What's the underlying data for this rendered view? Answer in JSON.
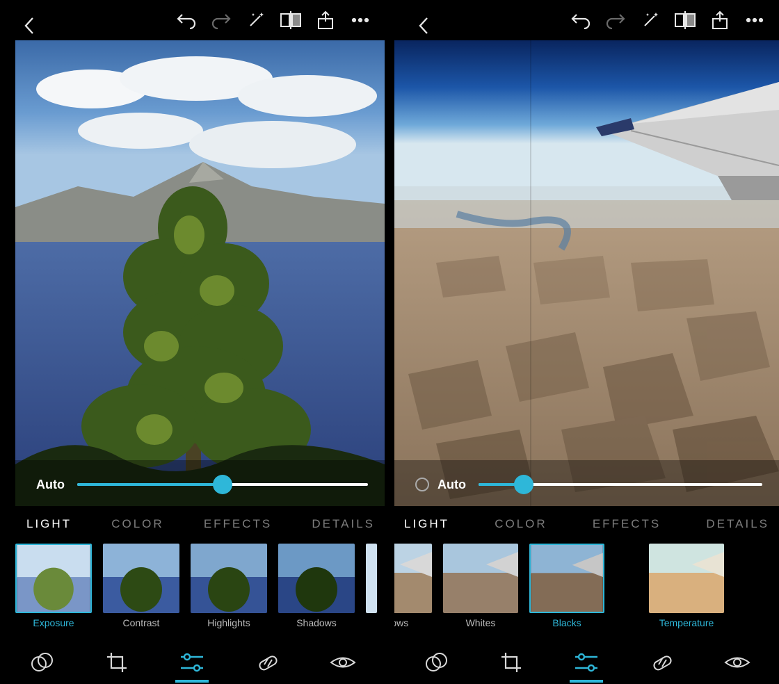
{
  "left": {
    "slider": {
      "auto_label": "Auto",
      "show_radio": false,
      "value_percent": 50
    },
    "tabs": [
      {
        "label": "LIGHT",
        "active": true
      },
      {
        "label": "COLOR",
        "active": false
      },
      {
        "label": "EFFECTS",
        "active": false
      },
      {
        "label": "DETAILS",
        "active": false
      }
    ],
    "presets": [
      {
        "label": "Exposure",
        "selected": true
      },
      {
        "label": "Contrast",
        "selected": false
      },
      {
        "label": "Highlights",
        "selected": false
      },
      {
        "label": "Shadows",
        "selected": false
      }
    ]
  },
  "right": {
    "slider": {
      "auto_label": "Auto",
      "show_radio": true,
      "value_percent": 16
    },
    "tabs": [
      {
        "label": "LIGHT",
        "active": true
      },
      {
        "label": "COLOR",
        "active": false
      },
      {
        "label": "EFFECTS",
        "active": false
      },
      {
        "label": "DETAILS",
        "active": false
      }
    ],
    "presets": [
      {
        "label": "adows",
        "selected": false
      },
      {
        "label": "Whites",
        "selected": false
      },
      {
        "label": "Blacks",
        "selected": true
      },
      {
        "label": "Temperature",
        "selected": false,
        "label_color": "blue"
      }
    ]
  },
  "icons": {
    "back": "back-icon",
    "undo": "undo-icon",
    "redo": "redo-icon",
    "magic": "magic-wand-icon",
    "compare": "compare-icon",
    "share": "share-icon",
    "more": "more-icon",
    "looks": "looks-icon",
    "crop": "crop-icon",
    "adjust": "adjust-sliders-icon",
    "heal": "heal-icon",
    "eye": "eye-icon"
  }
}
